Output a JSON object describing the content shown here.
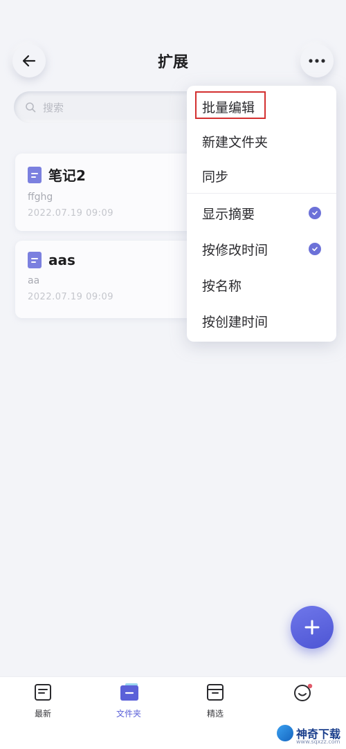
{
  "header": {
    "title": "扩展"
  },
  "search": {
    "placeholder": "搜索"
  },
  "notes": [
    {
      "title": "笔记2",
      "summary": "ffghg",
      "date": "2022.07.19 09:09"
    },
    {
      "title": "aas",
      "summary": "aa",
      "date": "2022.07.19 09:09"
    }
  ],
  "menu": {
    "items": [
      {
        "label": "批量编辑",
        "checked": false,
        "highlighted": true
      },
      {
        "label": "新建文件夹",
        "checked": false
      },
      {
        "label": "同步",
        "checked": false
      },
      {
        "label": "显示摘要",
        "checked": true
      },
      {
        "label": "按修改时间",
        "checked": true
      },
      {
        "label": "按名称",
        "checked": false
      },
      {
        "label": "按创建时间",
        "checked": false
      }
    ]
  },
  "tabbar": {
    "tabs": [
      {
        "label": "最新",
        "icon": "note-icon"
      },
      {
        "label": "文件夹",
        "icon": "folder-icon",
        "active": true
      },
      {
        "label": "精选",
        "icon": "archive-icon"
      },
      {
        "label": "",
        "icon": "smiley-icon",
        "badge": true
      }
    ]
  },
  "watermark": {
    "text": "神奇下载",
    "sub": "www.sqxzz.com"
  },
  "colors": {
    "accent": "#5a60d8",
    "highlight": "#d32f2f",
    "doc_icon": "#7b80df"
  }
}
